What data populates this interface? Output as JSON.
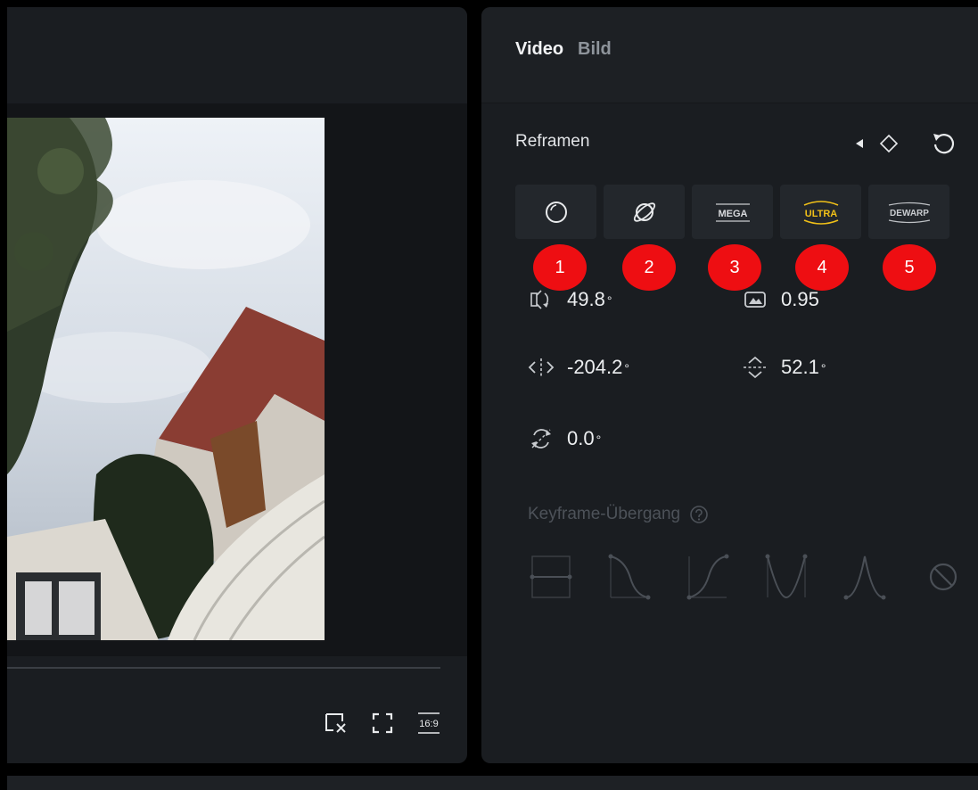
{
  "tabs": [
    {
      "label": "Video",
      "active": true
    },
    {
      "label": "Bild",
      "active": false
    }
  ],
  "reframe": {
    "title": "Reframen",
    "modes": [
      {
        "id": "circle",
        "icon": "circle-lens-icon",
        "label": ""
      },
      {
        "id": "planet",
        "icon": "planet-icon",
        "label": ""
      },
      {
        "id": "mega",
        "icon": "mega-icon",
        "label": "MEGA"
      },
      {
        "id": "ultra",
        "icon": "ultra-icon",
        "label": "ULTRA",
        "active": true
      },
      {
        "id": "dewarp",
        "icon": "dewarp-icon",
        "label": "DEWARP"
      }
    ],
    "badges": [
      "1",
      "2",
      "3",
      "4",
      "5"
    ]
  },
  "params": {
    "fov": {
      "value": "49.8",
      "unit": "°"
    },
    "distortion": {
      "value": "0.95"
    },
    "pan": {
      "value": "-204.2",
      "unit": "°"
    },
    "tilt": {
      "value": "52.1",
      "unit": "°"
    },
    "roll": {
      "value": "0.0",
      "unit": "°"
    }
  },
  "keyframe": {
    "label": "Keyframe-Übergang",
    "curves": [
      "hold-curve-icon",
      "ease-out-curve-icon",
      "ease-in-curve-icon",
      "ease-in-out-curve-icon",
      "bell-curve-icon",
      "none-icon"
    ]
  },
  "preview_tools": {
    "aspect_label": "16:9"
  },
  "colors": {
    "accent_ultra": "#f0c018",
    "badge": "#ee0e12",
    "panel": "#1a1d21"
  }
}
